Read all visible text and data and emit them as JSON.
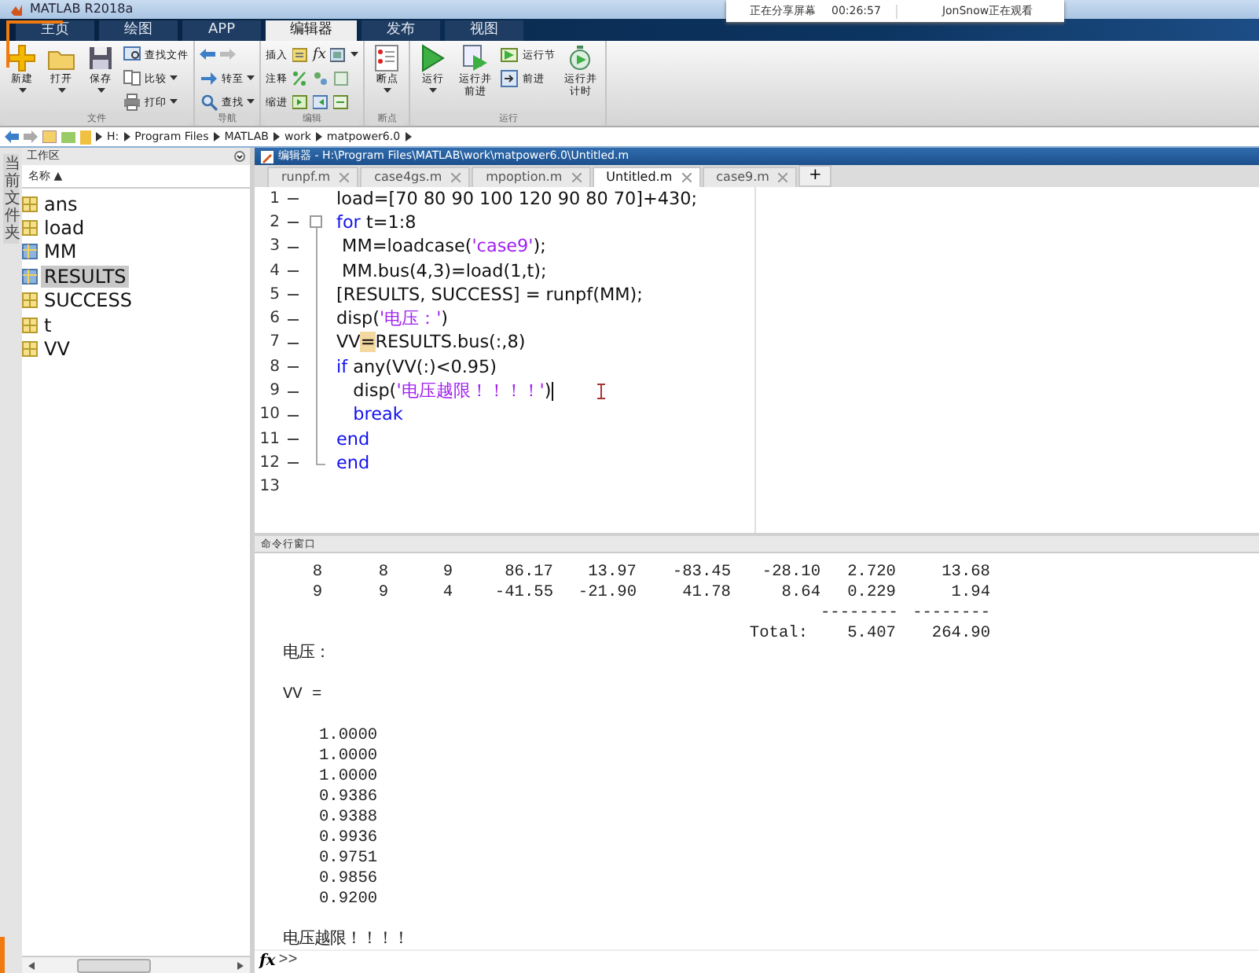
{
  "window": {
    "title": "MATLAB R2018a"
  },
  "screen_share": {
    "status": "正在分享屏幕",
    "time": "00:26:57",
    "viewer": "JonSnow正在观看"
  },
  "ribbon_tabs": [
    {
      "label": "主页",
      "selected": false
    },
    {
      "label": "绘图",
      "selected": false
    },
    {
      "label": "APP",
      "selected": false
    },
    {
      "label": "编辑器",
      "selected": true
    },
    {
      "label": "发布",
      "selected": false
    },
    {
      "label": "视图",
      "selected": false
    }
  ],
  "ribbon_groups": [
    {
      "label": "文件",
      "items": [
        {
          "kind": "large",
          "label": "新建",
          "dropdown": true
        },
        {
          "kind": "large",
          "label": "打开",
          "dropdown": true
        },
        {
          "kind": "large",
          "label": "保存",
          "dropdown": true
        },
        {
          "kind": "small",
          "label": "查找文件",
          "dropdown": false
        },
        {
          "kind": "small",
          "label": "比较",
          "dropdown": true
        },
        {
          "kind": "small",
          "label": "打印",
          "dropdown": true
        }
      ]
    },
    {
      "label": "导航",
      "items": [
        {
          "kind": "arrows"
        },
        {
          "kind": "small",
          "label": "转至",
          "dropdown": true
        },
        {
          "kind": "small",
          "label": "查找",
          "dropdown": true
        }
      ]
    },
    {
      "label": "编辑",
      "items": [
        {
          "kind": "tools",
          "label": "插入",
          "symbol": "fx",
          "dropdown": true
        },
        {
          "kind": "tools",
          "label": "注释",
          "dropdown": false
        },
        {
          "kind": "tools",
          "label": "缩进",
          "dropdown": false
        }
      ]
    },
    {
      "label": "断点",
      "items": [
        {
          "kind": "large",
          "label": "断点",
          "dropdown": true
        }
      ]
    },
    {
      "label": "运行",
      "items": [
        {
          "kind": "large",
          "label": "运行",
          "dropdown": true
        },
        {
          "kind": "large",
          "label": "运行并前进",
          "dropdown": false
        },
        {
          "kind": "small",
          "label": "运行节",
          "dropdown": false
        },
        {
          "kind": "small",
          "label": "前进",
          "dropdown": false
        },
        {
          "kind": "large",
          "label": "运行并计时",
          "dropdown": false
        }
      ]
    }
  ],
  "address_path": [
    "H:",
    "Program Files",
    "MATLAB",
    "work",
    "matpower6.0"
  ],
  "side_tab": "当前文件夹",
  "workspace": {
    "title": "工作区",
    "column": "名称 ▲",
    "variables": [
      {
        "name": "ans",
        "kind": "matrix",
        "selected": false
      },
      {
        "name": "load",
        "kind": "matrix",
        "selected": false
      },
      {
        "name": "MM",
        "kind": "struct",
        "selected": false
      },
      {
        "name": "RESULTS",
        "kind": "struct",
        "selected": true
      },
      {
        "name": "SUCCESS",
        "kind": "matrix",
        "selected": false
      },
      {
        "name": "t",
        "kind": "matrix",
        "selected": false
      },
      {
        "name": "VV",
        "kind": "matrix",
        "selected": false
      }
    ]
  },
  "editor": {
    "title": "编辑器 - H:\\Program Files\\MATLAB\\work\\matpower6.0\\Untitled.m",
    "tabs": [
      {
        "label": "runpf.m",
        "selected": false
      },
      {
        "label": "case4gs.m",
        "selected": false
      },
      {
        "label": "mpoption.m",
        "selected": false
      },
      {
        "label": "Untitled.m",
        "selected": true
      },
      {
        "label": "case9.m",
        "selected": false
      }
    ],
    "new_tab": "+",
    "lines": [
      {
        "number": "1",
        "executable": true,
        "fold_start": false,
        "in_fold": false,
        "fold_end": false,
        "segments": [
          {
            "kind": "plain",
            "text": "load=[70 80 90 100 120 90 80 70]+430;"
          }
        ]
      },
      {
        "number": "2",
        "executable": true,
        "fold_start": true,
        "in_fold": false,
        "fold_end": false,
        "segments": [
          {
            "kind": "keyword",
            "text": "for"
          },
          {
            "kind": "plain",
            "text": " t=1:8"
          }
        ]
      },
      {
        "number": "3",
        "executable": true,
        "fold_start": false,
        "in_fold": true,
        "fold_end": false,
        "segments": [
          {
            "kind": "plain",
            "text": " MM=loadcase("
          },
          {
            "kind": "string",
            "text": "'case9'"
          },
          {
            "kind": "plain",
            "text": ");"
          }
        ]
      },
      {
        "number": "4",
        "executable": true,
        "fold_start": false,
        "in_fold": true,
        "fold_end": false,
        "segments": [
          {
            "kind": "plain",
            "text": " MM.bus(4,3)=load(1,t);"
          }
        ]
      },
      {
        "number": "5",
        "executable": true,
        "fold_start": false,
        "in_fold": true,
        "fold_end": false,
        "segments": [
          {
            "kind": "plain",
            "text": "[RESULTS, SUCCESS] = runpf(MM);"
          }
        ]
      },
      {
        "number": "6",
        "executable": true,
        "fold_start": false,
        "in_fold": true,
        "fold_end": false,
        "segments": [
          {
            "kind": "plain",
            "text": "disp("
          },
          {
            "kind": "string",
            "text": "'电压：'"
          },
          {
            "kind": "plain",
            "text": ")"
          }
        ]
      },
      {
        "number": "7",
        "executable": true,
        "fold_start": false,
        "in_fold": true,
        "fold_end": false,
        "segments": [
          {
            "kind": "plain",
            "text": "VV"
          },
          {
            "kind": "match",
            "text": "="
          },
          {
            "kind": "plain",
            "text": "RESULTS.bus(:,8)"
          }
        ]
      },
      {
        "number": "8",
        "executable": true,
        "fold_start": false,
        "in_fold": true,
        "fold_end": false,
        "segments": [
          {
            "kind": "keyword",
            "text": "if"
          },
          {
            "kind": "plain",
            "text": " any(VV(:)<0.95)"
          }
        ]
      },
      {
        "number": "9",
        "executable": true,
        "fold_start": false,
        "in_fold": true,
        "fold_end": false,
        "cursor": true,
        "segments": [
          {
            "kind": "plain",
            "text": "   disp("
          },
          {
            "kind": "string",
            "text": "'电压越限！！！！'"
          },
          {
            "kind": "plain",
            "text": ")"
          }
        ]
      },
      {
        "number": "10",
        "executable": true,
        "fold_start": false,
        "in_fold": true,
        "fold_end": false,
        "segments": [
          {
            "kind": "keyword",
            "text": "   break"
          }
        ]
      },
      {
        "number": "11",
        "executable": true,
        "fold_start": false,
        "in_fold": true,
        "fold_end": false,
        "segments": [
          {
            "kind": "keyword",
            "text": "end"
          }
        ]
      },
      {
        "number": "12",
        "executable": true,
        "fold_start": false,
        "in_fold": false,
        "fold_end": true,
        "segments": [
          {
            "kind": "keyword",
            "text": "end"
          }
        ]
      },
      {
        "number": "13",
        "executable": false,
        "fold_start": false,
        "in_fold": false,
        "fold_end": false
      }
    ]
  },
  "command_window": {
    "title": "命令行窗口",
    "output": [
      {
        "kind": "row",
        "cells": [
          "8",
          "8",
          "9",
          "86.17",
          "13.97",
          "-83.45",
          "-28.10",
          "2.720",
          "13.68"
        ]
      },
      {
        "kind": "row",
        "cells": [
          "9",
          "9",
          "4",
          "-41.55",
          "-21.90",
          "41.78",
          "8.64",
          "0.229",
          "1.94"
        ]
      },
      {
        "kind": "rule",
        "cells": [
          "--------",
          "--------"
        ]
      },
      {
        "kind": "total",
        "label": "Total:",
        "cells": [
          "5.407",
          "264.90"
        ]
      },
      {
        "kind": "text",
        "text": "电压："
      },
      {
        "kind": "blank"
      },
      {
        "kind": "text",
        "text": "VV ="
      },
      {
        "kind": "blank"
      },
      {
        "kind": "value",
        "text": "1.0000"
      },
      {
        "kind": "value",
        "text": "1.0000"
      },
      {
        "kind": "value",
        "text": "1.0000"
      },
      {
        "kind": "value",
        "text": "0.9386"
      },
      {
        "kind": "value",
        "text": "0.9388"
      },
      {
        "kind": "value",
        "text": "0.9936"
      },
      {
        "kind": "value",
        "text": "0.9751"
      },
      {
        "kind": "value",
        "text": "0.9856"
      },
      {
        "kind": "value",
        "text": "0.9200"
      },
      {
        "kind": "blank"
      },
      {
        "kind": "text",
        "text": "电压越限！！！！"
      }
    ],
    "prompt_symbol": "fx",
    "prompt": ">>"
  }
}
